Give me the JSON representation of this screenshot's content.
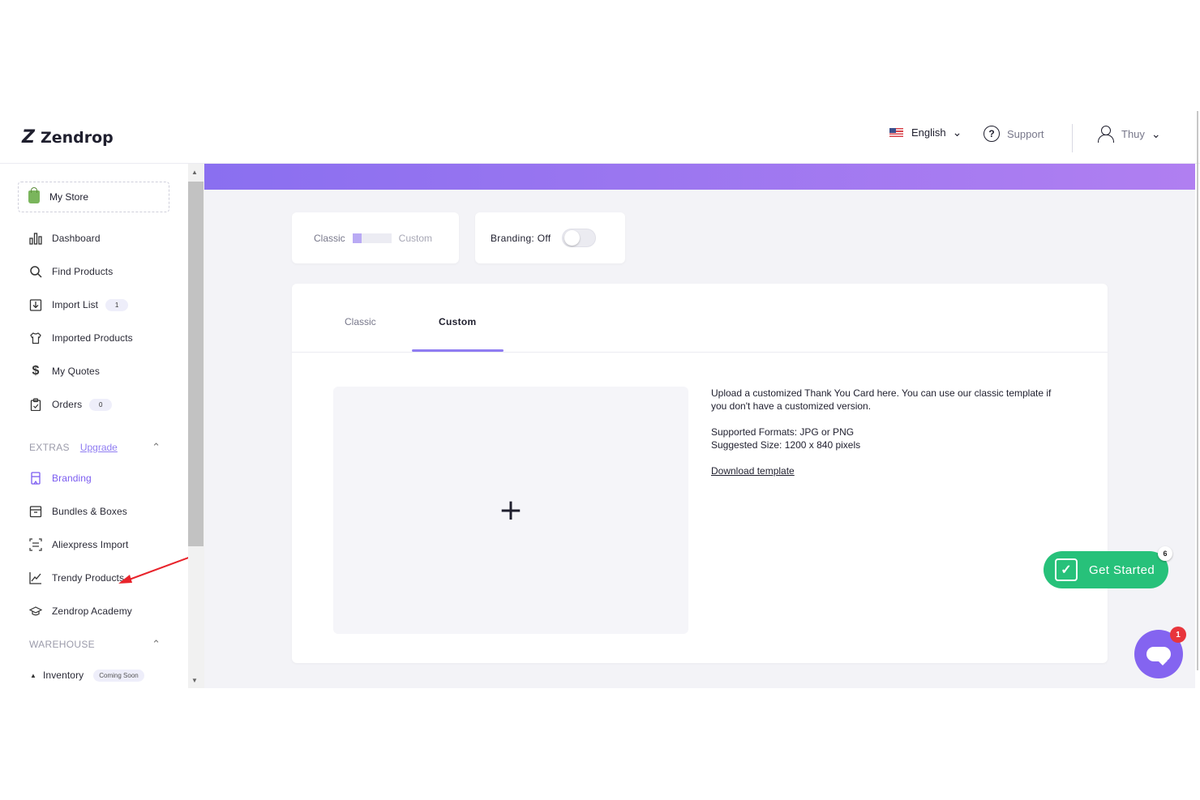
{
  "header": {
    "brand": "Zendrop",
    "language": "English",
    "support_label": "Support",
    "user_name": "Thuy"
  },
  "sidebar": {
    "store": "My Store",
    "items": [
      {
        "label": "Dashboard",
        "icon": "bar-chart-icon"
      },
      {
        "label": "Find Products",
        "icon": "search-icon"
      },
      {
        "label": "Import List",
        "icon": "import-icon",
        "count": "1"
      },
      {
        "label": "Imported Products",
        "icon": "shirt-icon"
      },
      {
        "label": "My Quotes",
        "icon": "dollar-icon"
      },
      {
        "label": "Orders",
        "icon": "clipboard-icon",
        "count": "0"
      }
    ],
    "extras": {
      "title": "EXTRAS",
      "upgrade": "Upgrade",
      "items": [
        {
          "label": "Branding",
          "icon": "branding-icon",
          "active": true
        },
        {
          "label": "Bundles & Boxes",
          "icon": "box-icon"
        },
        {
          "label": "Aliexpress Import",
          "icon": "aliexpress-icon"
        },
        {
          "label": "Trendy Products",
          "icon": "trend-icon"
        },
        {
          "label": "Zendrop Academy",
          "icon": "graduation-cap-icon"
        }
      ]
    },
    "warehouse": {
      "title": "WAREHOUSE",
      "items": [
        {
          "label": "Inventory",
          "icon": "inventory-icon",
          "badge": "Coming Soon"
        }
      ]
    }
  },
  "main": {
    "mode_toggle": {
      "left": "Classic",
      "right": "Custom"
    },
    "branding_label": "Branding: Off",
    "tabs": [
      {
        "label": "Classic"
      },
      {
        "label": "Custom",
        "active": true
      }
    ],
    "upload_plus": "+",
    "info": {
      "description": "Upload a customized Thank You Card here. You can use our classic template if you don't have a customized version.",
      "formats": "Supported Formats: JPG or PNG",
      "size": "Suggested Size: 1200 x 840 pixels",
      "download": "Download template"
    }
  },
  "widgets": {
    "get_started": "Get Started",
    "get_started_count": "6",
    "chat_count": "1"
  },
  "colors": {
    "accent": "#8f7cf2",
    "gradient_start": "#8a6ff0",
    "gradient_end": "#b07ff1",
    "get_started_green": "#27c17a",
    "chat_purple": "#8464f0",
    "annotation_red": "#e8232b"
  }
}
